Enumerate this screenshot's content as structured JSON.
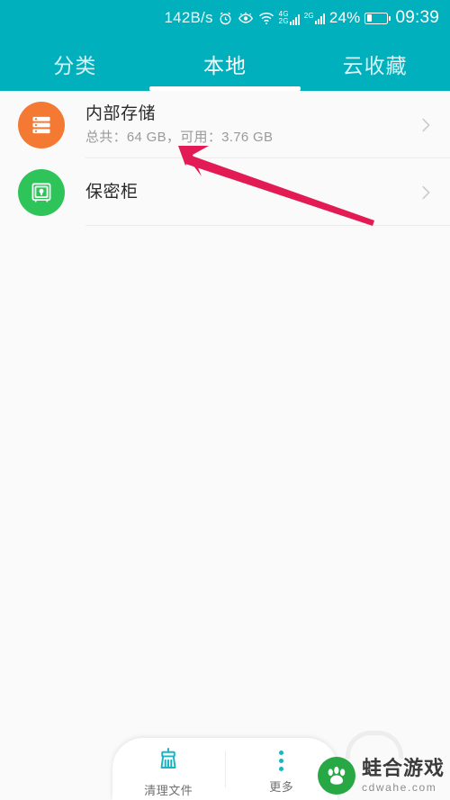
{
  "statusbar": {
    "net_speed": "142B/s",
    "icons": [
      "alarm-icon",
      "eye-icon",
      "wifi-icon",
      "signal-4g-icon",
      "signal-2g-icon"
    ],
    "signal_primary_label_top": "4G",
    "signal_primary_label_bottom": "2G",
    "signal_secondary_label": "2G",
    "battery_percent": "24%",
    "clock": "09:39"
  },
  "tabs": {
    "items": [
      {
        "label": "分类",
        "active": false
      },
      {
        "label": "本地",
        "active": true
      },
      {
        "label": "云收藏",
        "active": false
      }
    ]
  },
  "list": {
    "rows": [
      {
        "title": "内部存储",
        "subtitle": "总共：64 GB，可用：3.76 GB",
        "icon": "storage-stack-icon",
        "icon_color": "#f47a33",
        "chevron": "chevron-right-icon"
      },
      {
        "title": "保密柜",
        "subtitle": "",
        "icon": "safe-lock-icon",
        "icon_color": "#2fc45a",
        "chevron": "chevron-right-icon"
      }
    ]
  },
  "annotation": {
    "arrow_color": "#e31b54",
    "arrow_tip": "200,163",
    "arrow_tail": "416,243"
  },
  "bottombar": {
    "items": [
      {
        "label": "清理文件",
        "icon": "broom-icon"
      },
      {
        "label": "更多",
        "icon": "more-dots-icon"
      }
    ]
  },
  "watermark": {
    "title": "蛙合游戏",
    "subtitle": "cdwahe.com",
    "logo_color": "#27a845"
  },
  "colors": {
    "header_teal": "#00b0bd",
    "page_background": "#fafafa",
    "accent_teal": "#18b6c4",
    "divider": "#ececec"
  }
}
